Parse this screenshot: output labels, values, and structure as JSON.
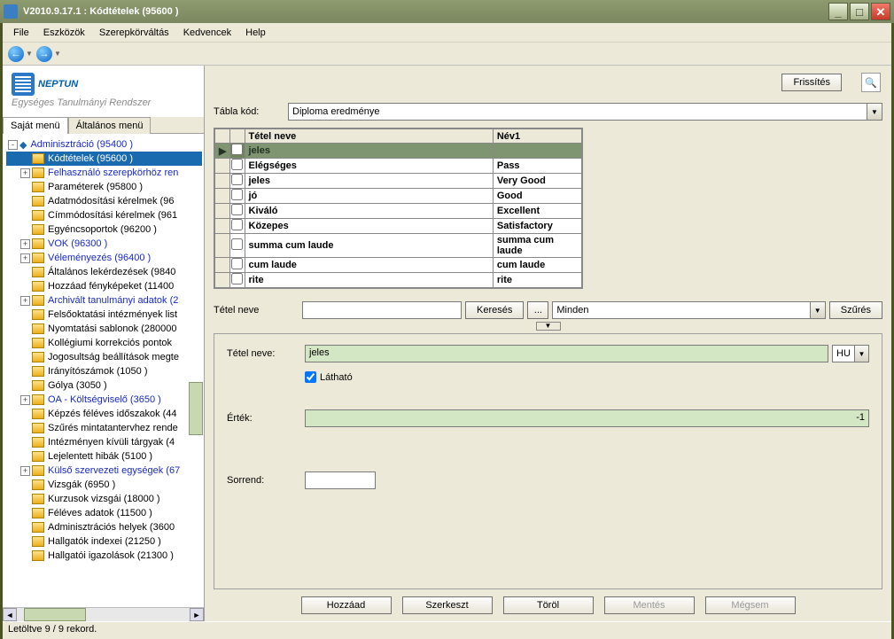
{
  "window": {
    "title": "V2010.9.17.1 : Kódtételek (95600  )"
  },
  "menu": {
    "items": [
      "File",
      "Eszközök",
      "Szerepkörváltás",
      "Kedvencek",
      "Help"
    ]
  },
  "logo": {
    "brand": "NEPTUN",
    "tagline": "Egységes Tanulmányi Rendszer"
  },
  "tree_tabs": {
    "active": "Saját menü",
    "inactive": "Általános menü"
  },
  "tree": [
    {
      "exp": "-",
      "lvl": 0,
      "text": "Adminisztráció (95400  )",
      "blue": true
    },
    {
      "exp": "",
      "lvl": 1,
      "text": "Kódtételek (95600  )",
      "selected": true,
      "blue": true
    },
    {
      "exp": "+",
      "lvl": 1,
      "text": "Felhasználó szerepkörhöz ren",
      "blue": true
    },
    {
      "exp": "",
      "lvl": 1,
      "text": "Paraméterek (95800  )"
    },
    {
      "exp": "",
      "lvl": 1,
      "text": "Adatmódosítási kérelmek (96"
    },
    {
      "exp": "",
      "lvl": 1,
      "text": "Címmódosítási kérelmek (961"
    },
    {
      "exp": "",
      "lvl": 1,
      "text": "Egyéncsoportok (96200  )"
    },
    {
      "exp": "+",
      "lvl": 1,
      "text": "VOK (96300  )",
      "blue": true
    },
    {
      "exp": "+",
      "lvl": 1,
      "text": "Véleményezés (96400  )",
      "blue": true
    },
    {
      "exp": "",
      "lvl": 1,
      "text": "Általános lekérdezések (9840"
    },
    {
      "exp": "",
      "lvl": 1,
      "text": "Hozzáad fényképeket (11400"
    },
    {
      "exp": "+",
      "lvl": 1,
      "text": "Archivált tanulmányi adatok (2",
      "blue": true
    },
    {
      "exp": "",
      "lvl": 1,
      "text": "Felsőoktatási intézmények list"
    },
    {
      "exp": "",
      "lvl": 1,
      "text": "Nyomtatási sablonok (280000"
    },
    {
      "exp": "",
      "lvl": 1,
      "text": "Kollégiumi korrekciós pontok"
    },
    {
      "exp": "",
      "lvl": 1,
      "text": "Jogosultság beállítások megte"
    },
    {
      "exp": "",
      "lvl": 1,
      "text": "Irányítószámok (1050  )"
    },
    {
      "exp": "",
      "lvl": 1,
      "text": "Gólya (3050  )"
    },
    {
      "exp": "+",
      "lvl": 1,
      "text": "OA - Költségviselő (3650  )",
      "blue": true
    },
    {
      "exp": "",
      "lvl": 1,
      "text": "Képzés féléves időszakok (44"
    },
    {
      "exp": "",
      "lvl": 1,
      "text": "Szűrés mintatantervhez rende"
    },
    {
      "exp": "",
      "lvl": 1,
      "text": "Intézményen kívüli tárgyak (4"
    },
    {
      "exp": "",
      "lvl": 1,
      "text": "Lejelentett hibák (5100  )"
    },
    {
      "exp": "+",
      "lvl": 1,
      "text": "Külső szervezeti egységek (67",
      "blue": true
    },
    {
      "exp": "",
      "lvl": 1,
      "text": "Vizsgák (6950  )"
    },
    {
      "exp": "",
      "lvl": 1,
      "text": "Kurzusok vizsgái (18000  )"
    },
    {
      "exp": "",
      "lvl": 1,
      "text": "Féléves adatok (11500  )"
    },
    {
      "exp": "",
      "lvl": 1,
      "text": "Adminisztrációs helyek (3600"
    },
    {
      "exp": "",
      "lvl": 1,
      "text": "Hallgatók indexei (21250  )"
    },
    {
      "exp": "",
      "lvl": 1,
      "text": "Hallgatói igazolások (21300  )"
    }
  ],
  "right": {
    "refresh_label": "Frissítés",
    "tabla_kod_label": "Tábla kód:",
    "tabla_kod_value": "Diploma eredménye",
    "grid": {
      "headers": {
        "h0": "",
        "h1": "Tétel neve",
        "h2": "Név1"
      },
      "rows": [
        {
          "c1": "jeles",
          "c2": "",
          "sel": true
        },
        {
          "c1": "Elégséges",
          "c2": "Pass"
        },
        {
          "c1": "jeles",
          "c2": "Very Good"
        },
        {
          "c1": "jó",
          "c2": "Good"
        },
        {
          "c1": "Kiváló",
          "c2": "Excellent"
        },
        {
          "c1": "Közepes",
          "c2": "Satisfactory"
        },
        {
          "c1": "summa cum laude",
          "c2": "summa cum laude"
        },
        {
          "c1": "cum laude",
          "c2": "cum laude"
        },
        {
          "c1": "rite",
          "c2": "rite"
        }
      ]
    },
    "search": {
      "label": "Tétel neve",
      "value": "",
      "kereses": "Keresés",
      "dots": "...",
      "filter_value": "Minden",
      "szures": "Szűrés"
    },
    "detail": {
      "tetel_neve_label": "Tétel neve:",
      "tetel_neve_value": "jeles",
      "lang": "HU",
      "visible_label": "Látható",
      "visible_checked": true,
      "ertek_label": "Érték:",
      "ertek_value": "-1",
      "sorrend_label": "Sorrend:",
      "sorrend_value": ""
    },
    "actions": {
      "add": "Hozzáad",
      "edit": "Szerkeszt",
      "delete": "Töröl",
      "save": "Mentés",
      "cancel": "Mégsem"
    }
  },
  "status": {
    "text": "Letöltve 9 / 9 rekord."
  }
}
